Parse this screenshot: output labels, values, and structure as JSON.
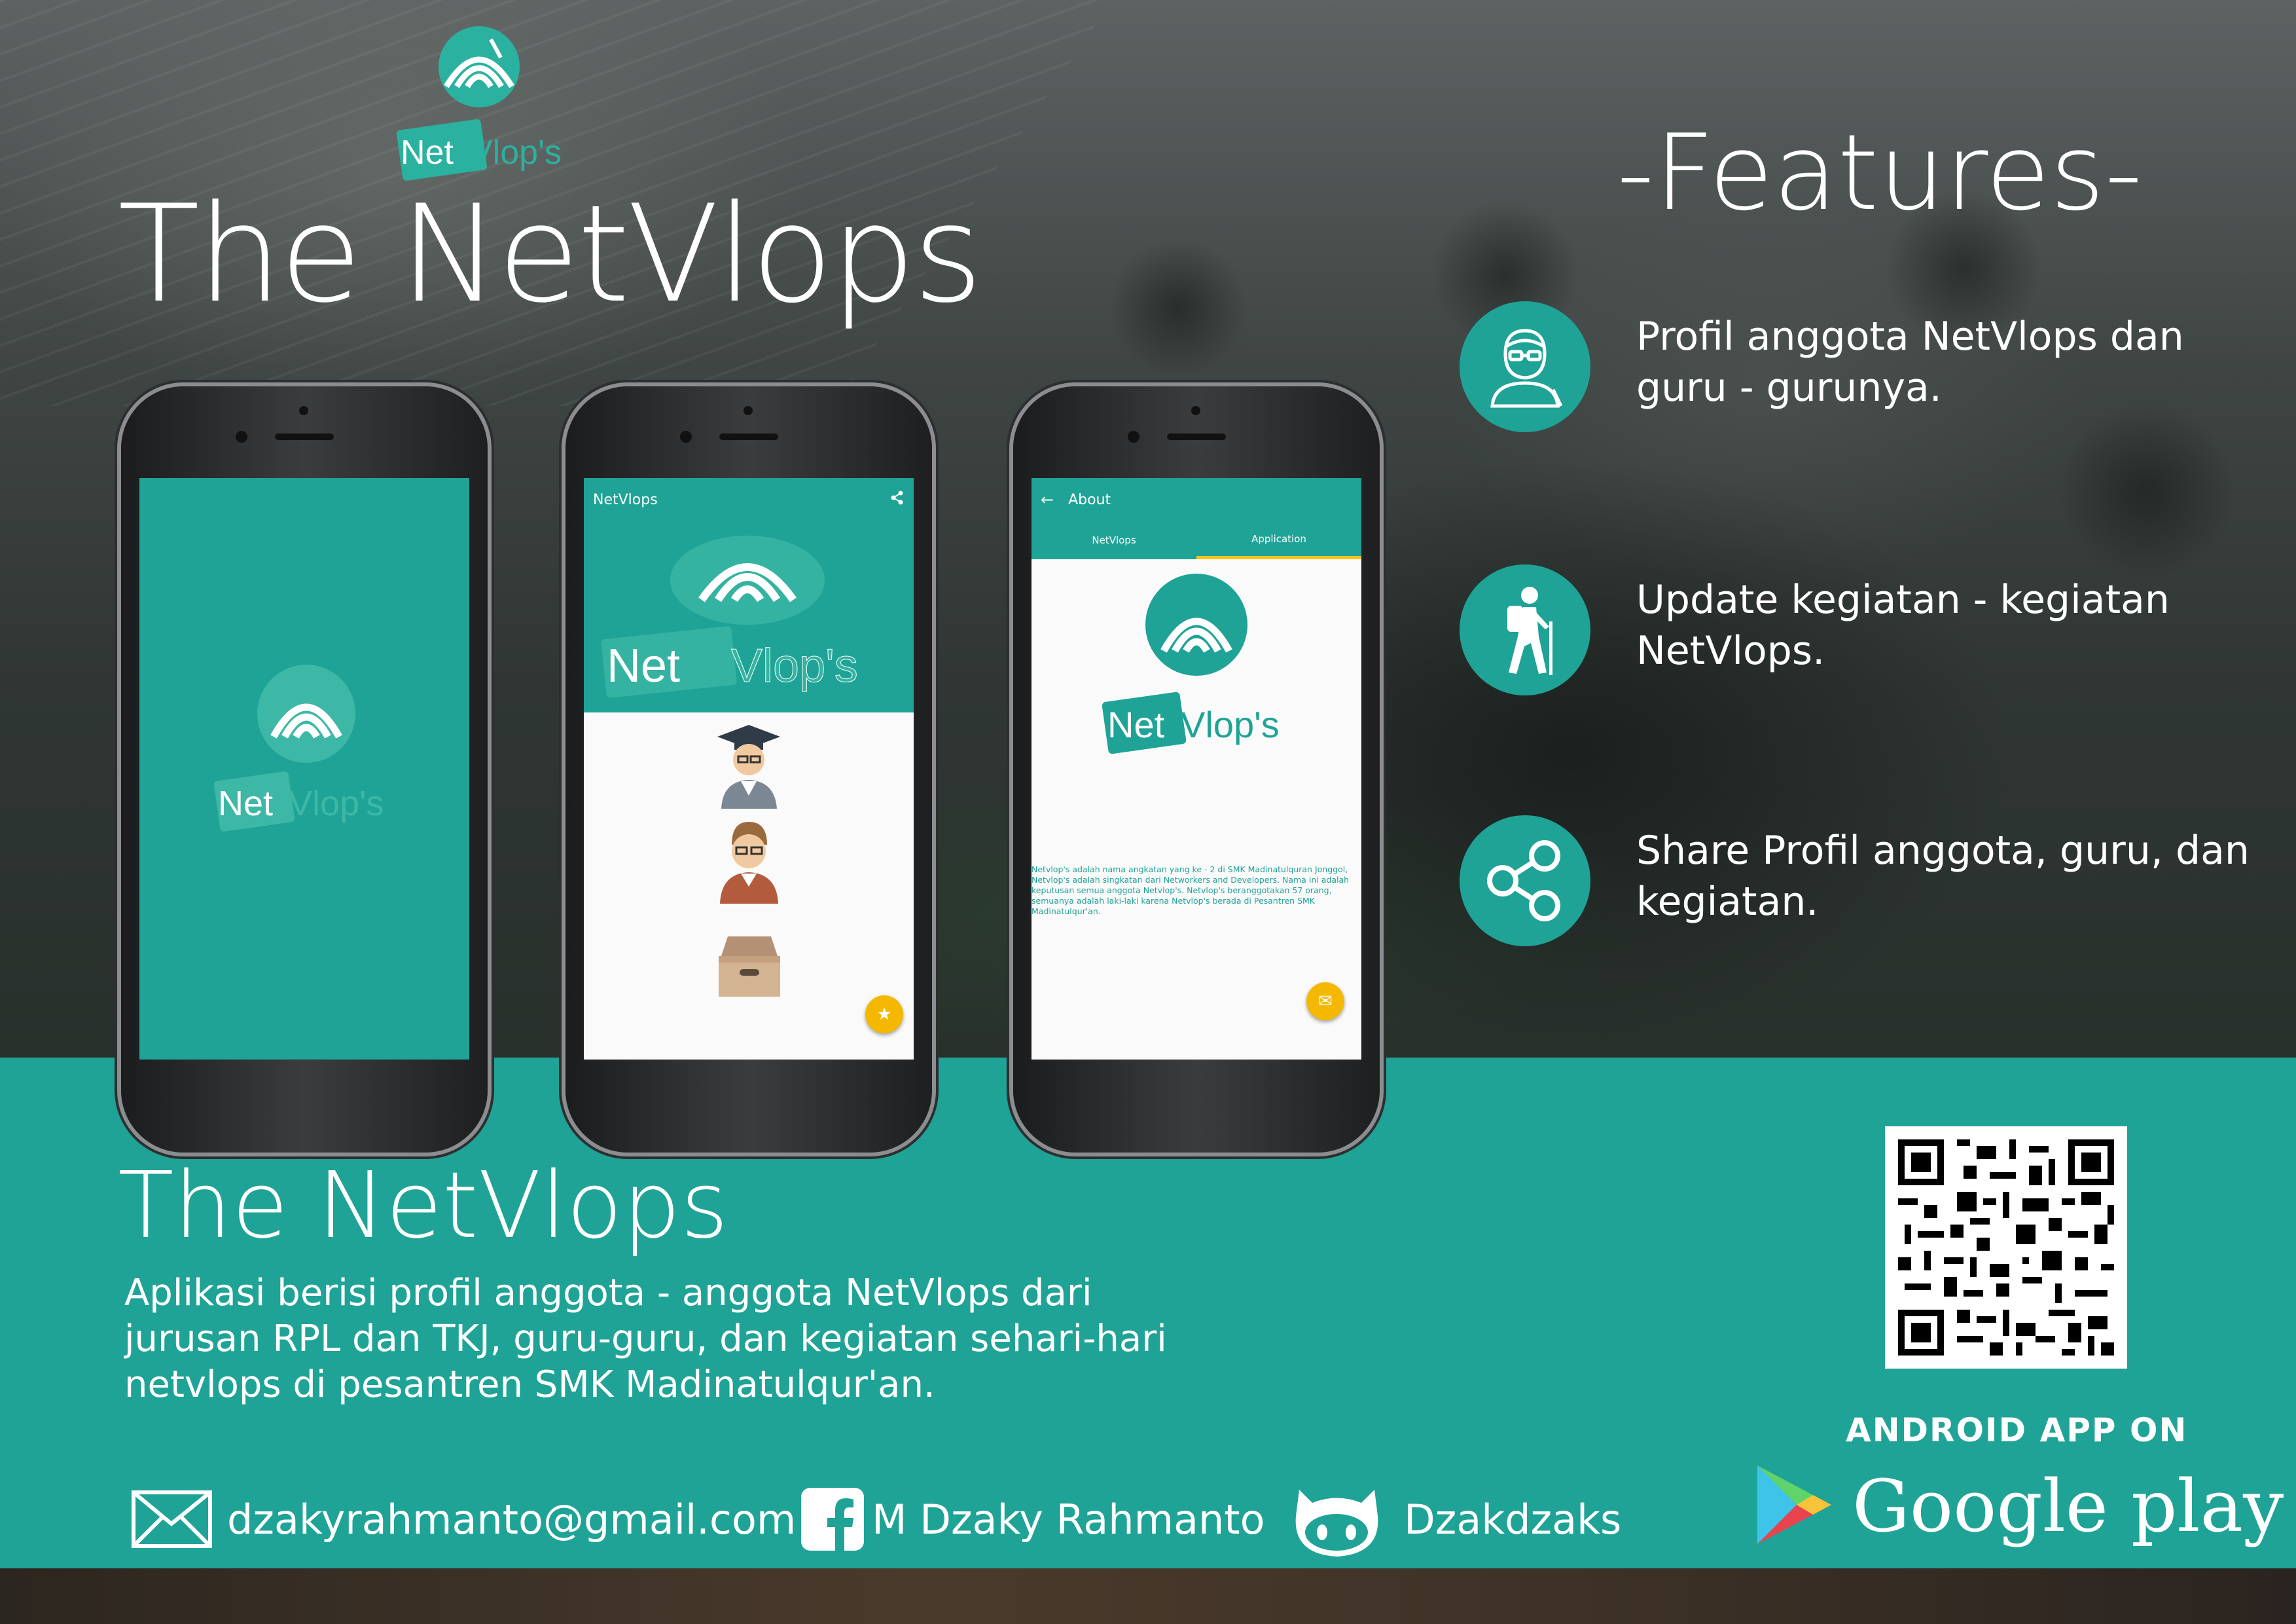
{
  "header": {
    "logo_text": "NetVlop's",
    "title": "The NetVlops",
    "features_title": "-Features-"
  },
  "features": [
    {
      "icon": "teacher-icon",
      "text": "Profil anggota NetVlops dan guru - gurunya."
    },
    {
      "icon": "hiker-icon",
      "text": "Update kegiatan - kegiatan NetVlops."
    },
    {
      "icon": "share-icon",
      "text": "Share Profil anggota, guru, dan kegiatan."
    }
  ],
  "phone_home": {
    "appbar_title": "NetVlops",
    "list_icons": [
      "graduate-icon",
      "teacher-icon",
      "archive-box-icon"
    ],
    "fab_icon": "star-icon"
  },
  "phone_about": {
    "appbar_title": "About",
    "tabs": [
      "NetVlops",
      "Application"
    ],
    "active_tab": "Application",
    "body": "Netvlop's adalah nama angkatan yang ke - 2 di SMK Madinatulquran Jonggol, Netvlop's adalah singkatan dari Networkers and Developers. Nama ini adalah keputusan semua anggota Netvlop's. Netvlop's beranggotakan 57 orang, semuanya adalah laki-laki karena Netvlop's berada di Pesantren SMK Madinatulqur'an.",
    "fab_icon": "mail-icon"
  },
  "bottom": {
    "title": "The NetVlops",
    "description": "Aplikasi berisi profil anggota - anggota NetVlops dari jurusan RPL dan TKJ, guru-guru, dan kegiatan sehari-hari netvlops di pesantren SMK Madinatulqur'an.",
    "email": "dzakyrahmanto@gmail.com",
    "facebook": "M Dzaky Rahmanto",
    "github": "Dzakdzaks",
    "android_label": "ANDROID APP ON",
    "store_name": "Google play"
  },
  "colors": {
    "teal": "#1fa396",
    "accent_yellow": "#f5b800",
    "text_white": "#ffffff"
  }
}
